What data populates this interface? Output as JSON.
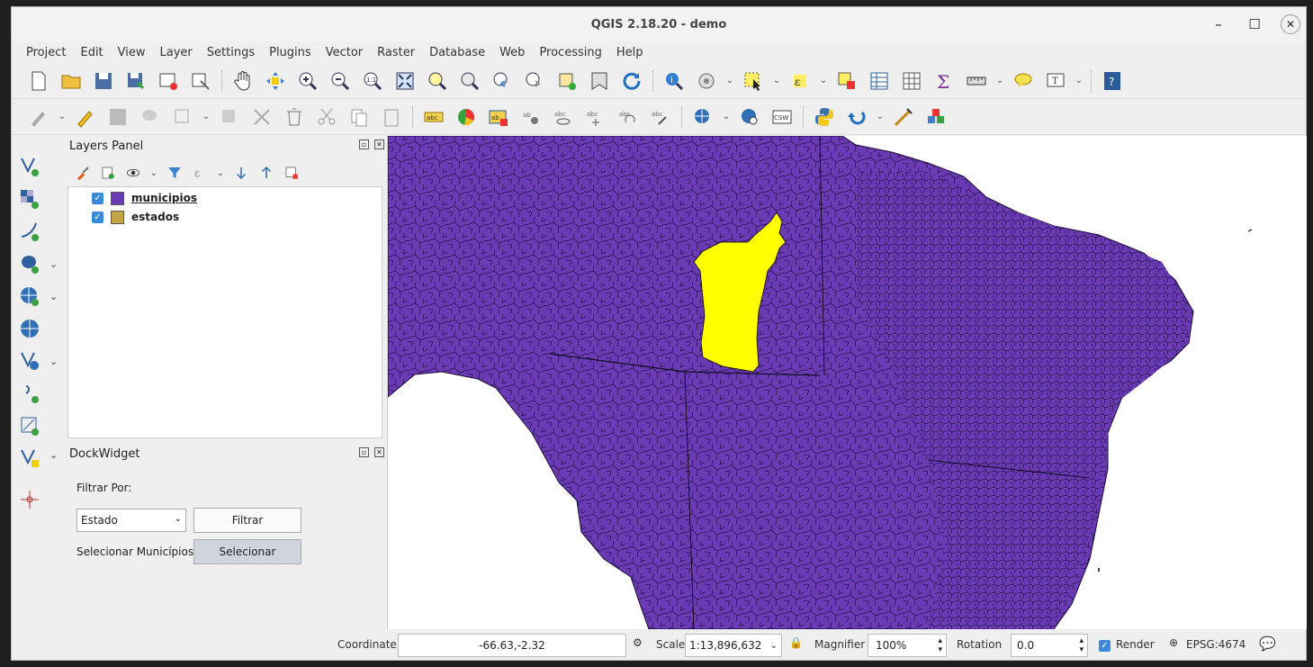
{
  "window": {
    "title": "QGIS 2.18.20 - demo"
  },
  "menu": [
    "Project",
    "Edit",
    "View",
    "Layer",
    "Settings",
    "Plugins",
    "Vector",
    "Raster",
    "Database",
    "Web",
    "Processing",
    "Help"
  ],
  "layers_panel": {
    "title": "Layers Panel",
    "layers": [
      {
        "name": "municipios",
        "color": "#6a3bb5",
        "checked": true
      },
      {
        "name": "estados",
        "color": "#c4a445",
        "checked": true
      }
    ]
  },
  "dock_widget": {
    "title": "DockWidget",
    "filter_label": "Filtrar Por:",
    "filter_select_value": "Estado",
    "filter_button": "Filtrar",
    "select_label": "Selecionar Municípios",
    "select_button": "Selecionar"
  },
  "status": {
    "coordinate_label": "Coordinate",
    "coordinate_value": "-66.63,-2.32",
    "scale_label": "Scale",
    "scale_value": "1:13,896,632",
    "magnifier_label": "Magnifier",
    "magnifier_value": "100%",
    "rotation_label": "Rotation",
    "rotation_value": "0.0",
    "render_label": "Render",
    "crs": "EPSG:4674"
  },
  "colors": {
    "municipio_fill": "#6a3bb5",
    "selected_fill": "#ffff00",
    "estado_swatch": "#c4a445"
  }
}
